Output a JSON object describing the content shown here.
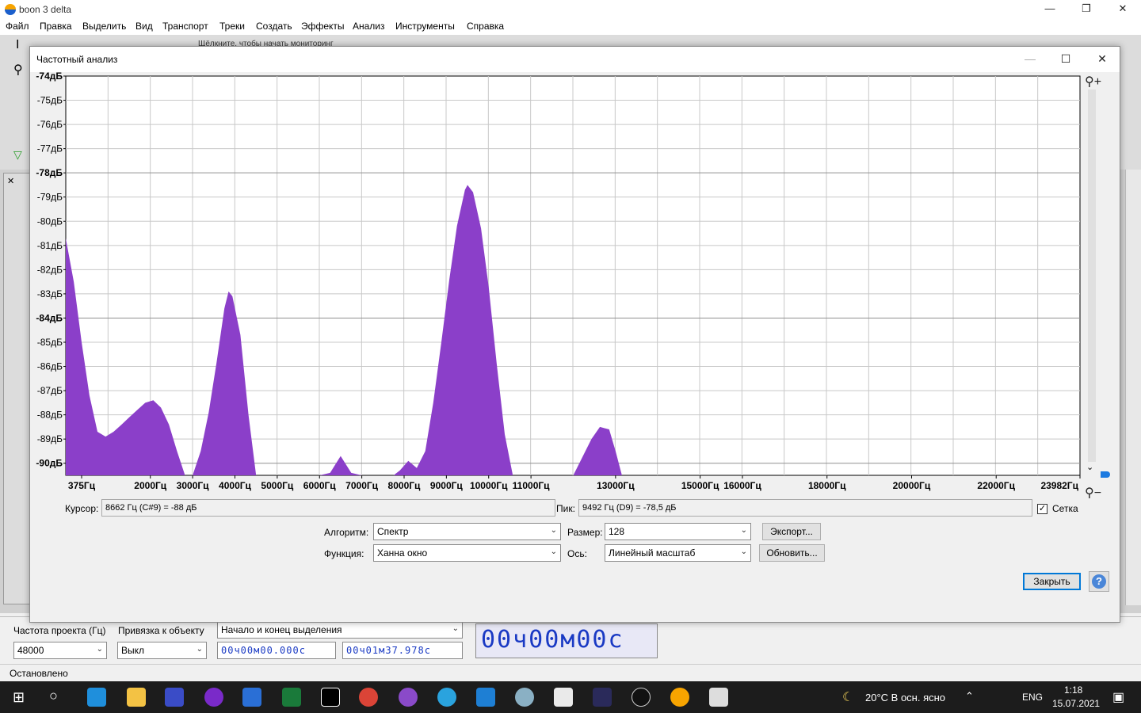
{
  "app": {
    "title": "boon 3 delta",
    "menu": [
      "Файл",
      "Правка",
      "Выделить",
      "Вид",
      "Транспорт",
      "Треки",
      "Создать",
      "Эффекты",
      "Анализ",
      "Инструменты",
      "Справка"
    ],
    "meter_hint": "Щёлкните, чтобы начать мониторинг"
  },
  "dialog": {
    "title": "Частотный анализ",
    "cursor_label": "Курсор:",
    "cursor_value": "8662 Гц (C#9) = -88 дБ",
    "peak_label": "Пик:",
    "peak_value": "9492 Гц (D9) = -78,5 дБ",
    "grid_label": "Сетка",
    "grid_checked": true,
    "algorithm_label": "Алгоритм:",
    "algorithm_value": "Спектр",
    "size_label": "Размер:",
    "size_value": "128",
    "function_label": "Функция:",
    "function_value": "Ханна  окно",
    "axis_label": "Ось:",
    "axis_value": "Линейный масштаб",
    "export_button": "Экспорт...",
    "refresh_button": "Обновить...",
    "close_button": "Закрыть",
    "help_glyph": "?"
  },
  "chart_data": {
    "type": "area",
    "fill_color": "#8b3fc9",
    "grid": true,
    "y_ticks": [
      "-74дБ",
      "-75дБ",
      "-76дБ",
      "-77дБ",
      "-78дБ",
      "-79дБ",
      "-80дБ",
      "-81дБ",
      "-82дБ",
      "-83дБ",
      "-84дБ",
      "-85дБ",
      "-86дБ",
      "-87дБ",
      "-88дБ",
      "-89дБ",
      "-90дБ"
    ],
    "ylim": [
      -90,
      -74
    ],
    "x_ticks": [
      "375Гц",
      "2000Гц",
      "3000Гц",
      "4000Гц",
      "5000Гц",
      "6000Гц",
      "7000Гц",
      "8000Гц",
      "9000Гц",
      "10000Гц",
      "11000Гц",
      "13000Гц",
      "15000Гц",
      "16000Гц",
      "18000Гц",
      "20000Гц",
      "22000Гц",
      "23982Гц"
    ],
    "x_tick_values": [
      375,
      2000,
      3000,
      4000,
      5000,
      6000,
      7000,
      8000,
      9000,
      10000,
      11000,
      13000,
      15000,
      16000,
      18000,
      20000,
      22000,
      23982
    ],
    "xlim": [
      0,
      23982
    ],
    "points": [
      [
        0,
        -80.7
      ],
      [
        190,
        -82.5
      ],
      [
        375,
        -85
      ],
      [
        560,
        -87.2
      ],
      [
        750,
        -88.7
      ],
      [
        940,
        -88.9
      ],
      [
        1130,
        -88.7
      ],
      [
        1320,
        -88.4
      ],
      [
        1500,
        -88.1
      ],
      [
        1690,
        -87.8
      ],
      [
        1880,
        -87.5
      ],
      [
        2070,
        -87.4
      ],
      [
        2250,
        -87.7
      ],
      [
        2440,
        -88.4
      ],
      [
        2630,
        -89.5
      ],
      [
        2820,
        -90.5
      ],
      [
        3000,
        -90.5
      ],
      [
        3190,
        -89.5
      ],
      [
        3380,
        -87.9
      ],
      [
        3570,
        -85.8
      ],
      [
        3750,
        -83.6
      ],
      [
        3850,
        -82.9
      ],
      [
        3940,
        -83.1
      ],
      [
        4130,
        -84.7
      ],
      [
        4320,
        -88
      ],
      [
        4500,
        -90.5
      ],
      [
        5000,
        -90.5
      ],
      [
        6000,
        -90.5
      ],
      [
        6250,
        -90.4
      ],
      [
        6500,
        -89.7
      ],
      [
        6750,
        -90.4
      ],
      [
        7000,
        -90.5
      ],
      [
        7750,
        -90.5
      ],
      [
        7900,
        -90.3
      ],
      [
        8100,
        -89.9
      ],
      [
        8300,
        -90.2
      ],
      [
        8500,
        -89.5
      ],
      [
        8690,
        -87.5
      ],
      [
        8880,
        -85
      ],
      [
        9070,
        -82.4
      ],
      [
        9250,
        -80.2
      ],
      [
        9440,
        -78.7
      ],
      [
        9500,
        -78.5
      ],
      [
        9630,
        -78.8
      ],
      [
        9820,
        -80.3
      ],
      [
        10000,
        -82.7
      ],
      [
        10190,
        -85.9
      ],
      [
        10380,
        -88.8
      ],
      [
        10570,
        -90.5
      ],
      [
        12000,
        -90.5
      ],
      [
        12200,
        -89.8
      ],
      [
        12430,
        -89
      ],
      [
        12630,
        -88.5
      ],
      [
        12850,
        -88.6
      ],
      [
        13000,
        -89.5
      ],
      [
        13150,
        -90.5
      ],
      [
        23982,
        -90.5
      ]
    ]
  }
}
